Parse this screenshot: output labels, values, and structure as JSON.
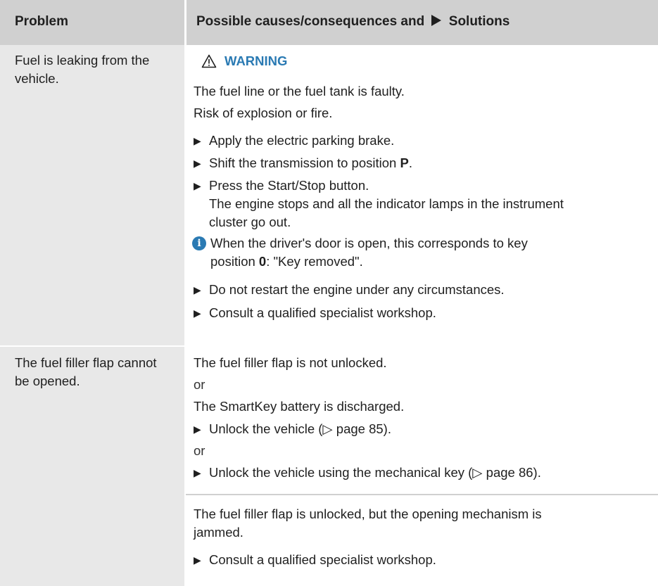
{
  "header": {
    "problem": "Problem",
    "causes_prefix": "Possible causes/consequences and",
    "causes_suffix": "Solutions"
  },
  "row1": {
    "problem": "Fuel is leaking from the vehicle.",
    "warning_title": "WARNING",
    "lines": [
      "The fuel line or the fuel tank is faulty.",
      "Risk of explosion or fire."
    ],
    "step1": "Apply the electric parking brake.",
    "step2_prefix": "Shift the transmission to position ",
    "step2_bold": "P",
    "step2_suffix": ".",
    "step3": "Press the Start/Stop button.",
    "step3_result_1": "The engine stops and all the indicator lamps in the instrument",
    "step3_result_2": "cluster go out.",
    "info_1": "When the driver's door is open, this corresponds to key",
    "info_2_prefix": "position ",
    "info_2_bold": "0",
    "info_2_suffix": ": \"Key removed\".",
    "step4": "Do not restart the engine under any circumstances.",
    "step5": "Consult a qualified specialist workshop."
  },
  "row2": {
    "problem": "The fuel filler flap cannot be opened.",
    "line1": "The fuel filler flap is not unlocked.",
    "or1": "or",
    "line2": "The SmartKey battery is discharged.",
    "step1": "Unlock the vehicle (▷ page 85).",
    "or2": "or",
    "step2": "Unlock the vehicle using the mechanical key (▷ page 86)."
  },
  "row3": {
    "line1": "The fuel filler flap is unlocked, but the opening mechanism is",
    "line2": "jammed.",
    "step1": "Consult a qualified specialist workshop."
  },
  "colors": {
    "header_bg": "#d0d0d0",
    "problem_col_bg": "#e8e8e8",
    "accent_blue": "#2a7ab3"
  },
  "icons": [
    "play-arrow-icon",
    "warning-triangle-icon",
    "info-icon",
    "bullet-arrow-icon"
  ]
}
